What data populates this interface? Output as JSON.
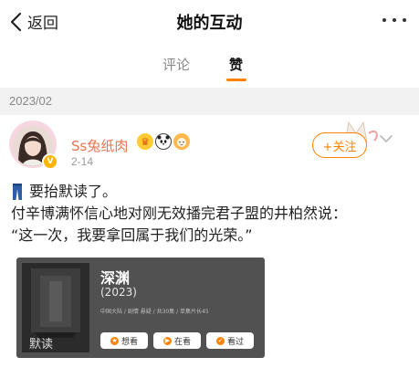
{
  "header": {
    "back_label": "返回",
    "title": "她的互动"
  },
  "tabs": [
    {
      "label": "评论",
      "active": false
    },
    {
      "label": "赞",
      "active": true
    }
  ],
  "accent_color": "#ff8200",
  "date_group": "2023/02",
  "post": {
    "username": "Ss兔纸肉",
    "username_color": "#eb7350",
    "time": "2-14",
    "follow_label": "+关注",
    "lines": [
      "要抬默读了。",
      "付辛博满怀信心地对刚无效播完君子盟的井柏然说：",
      "“这一次，我要拿回属于我们的光荣。”"
    ],
    "card": {
      "title": "深渊",
      "year": "(2023)",
      "meta": "中国大陆 / 剧情 悬疑 / 共30集 / 单集片长45",
      "poster_text": "默读",
      "buttons": [
        {
          "label": "想看",
          "icon": "star-icon"
        },
        {
          "label": "在看",
          "icon": "play-icon"
        },
        {
          "label": "看过",
          "icon": "check-icon"
        }
      ]
    }
  }
}
